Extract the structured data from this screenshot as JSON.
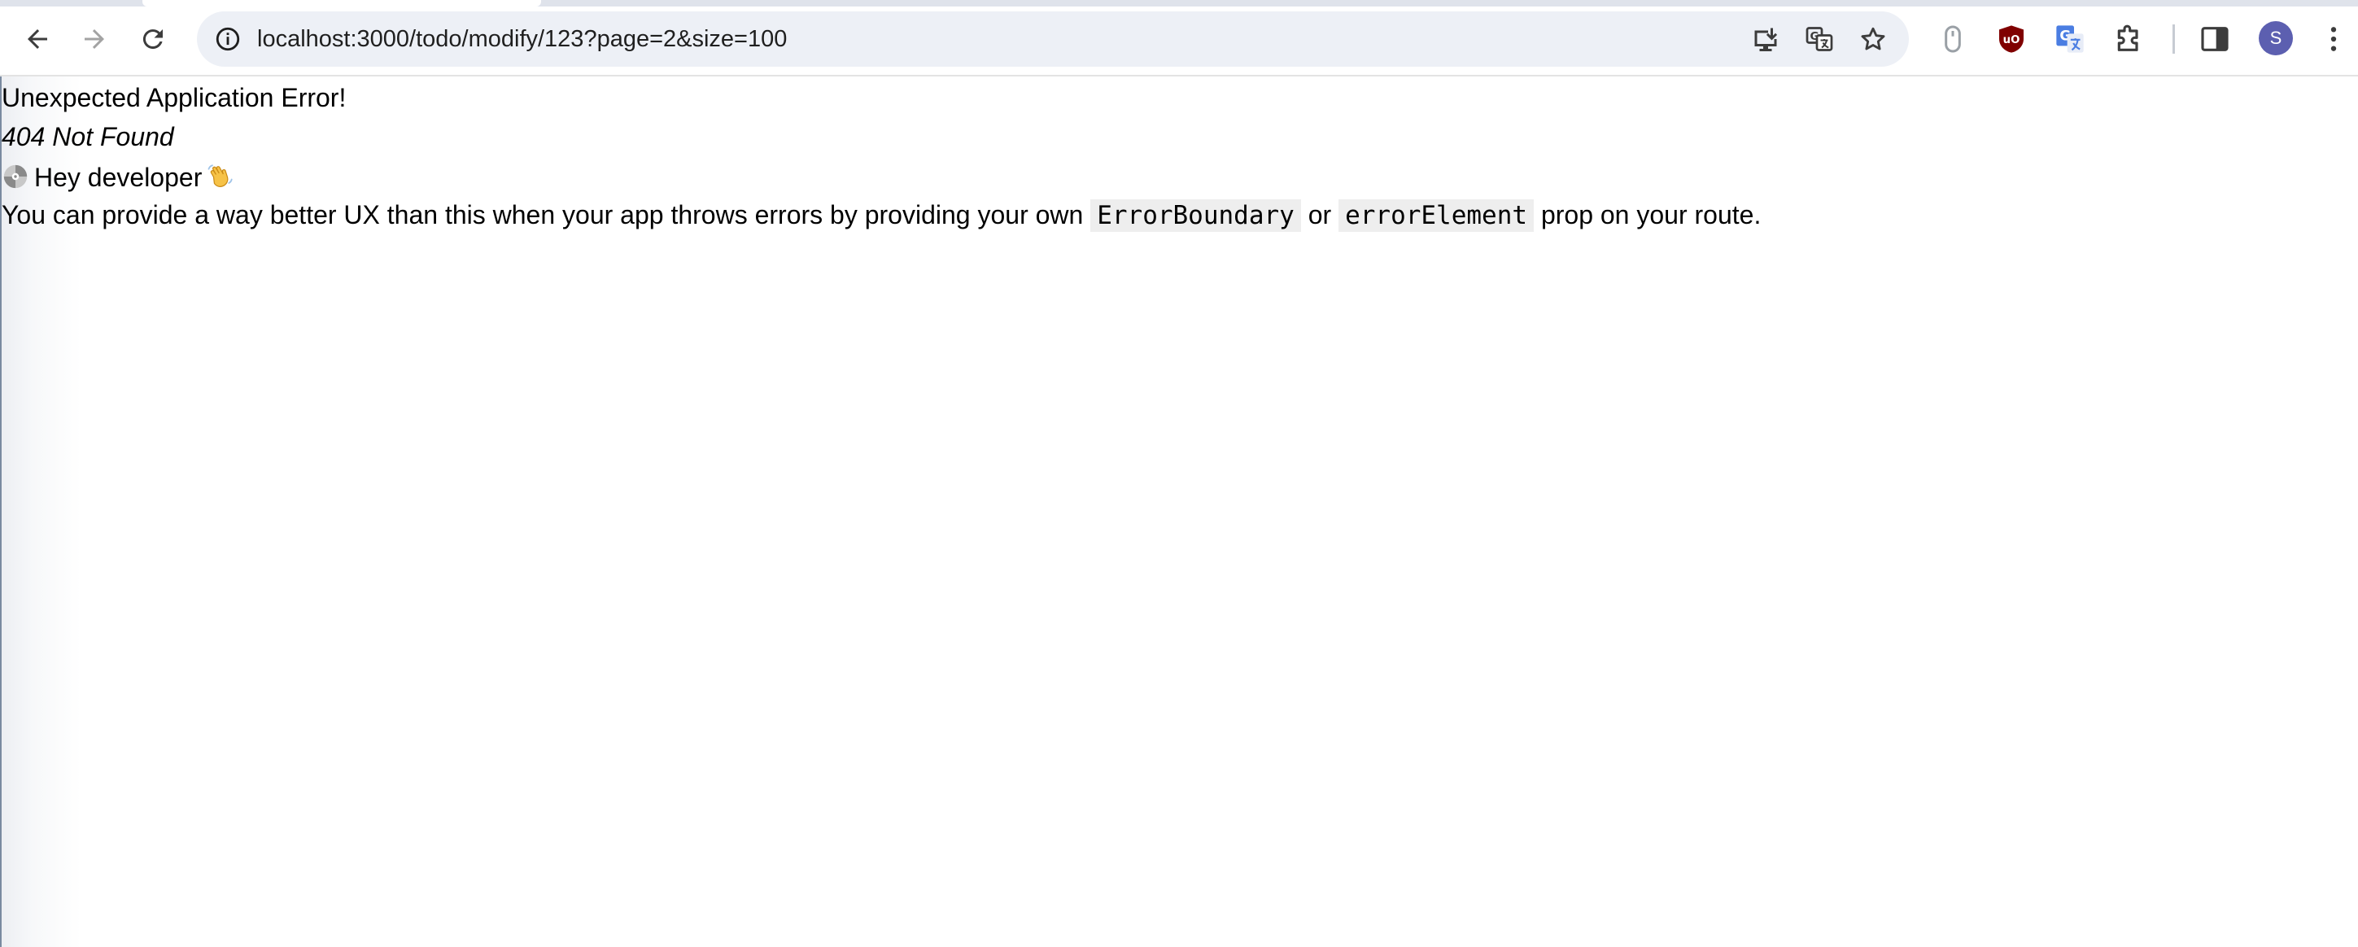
{
  "browser": {
    "url": "localhost:3000/todo/modify/123?page=2&size=100",
    "profile_initial": "S",
    "icons": {
      "back": "back-arrow-icon",
      "forward": "forward-arrow-icon",
      "reload": "reload-icon",
      "site_info": "info-icon",
      "install": "install-app-icon",
      "translate": "translate-icon",
      "bookmark": "star-icon",
      "ext1": "mouse-extension-icon",
      "ext2": "ublock-origin-icon",
      "ext3": "google-translate-extension-icon",
      "extensions": "puzzle-icon",
      "side_panel": "side-panel-icon",
      "menu": "kebab-menu-icon"
    }
  },
  "page": {
    "title": "Unexpected Application Error!",
    "status": "404 Not Found",
    "dev_greeting": "Hey developer",
    "message_prefix": "You can provide a way better UX than this when your app throws errors by providing your own",
    "code_1": "ErrorBoundary",
    "message_middle": "or",
    "code_2": "errorElement",
    "message_suffix": "prop on your route."
  },
  "colors": {
    "omnibox_bg": "#edf0f6",
    "avatar_bg": "#5c5fb0",
    "ublock_red": "#800000",
    "translate_blue": "#4a7de2",
    "code_bg": "#eeeeee"
  }
}
